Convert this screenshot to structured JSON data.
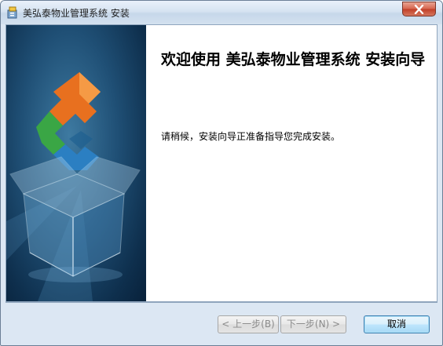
{
  "window": {
    "title": "美弘泰物业管理系统 安装",
    "icon": "installer-icon",
    "close_icon": "close-icon"
  },
  "content": {
    "heading": "欢迎使用 美弘泰物业管理系统 安装向导",
    "message": "请稍候，安装向导正准备指导您完成安装。"
  },
  "banner": {
    "image": "puzzle-box-illustration"
  },
  "buttons": {
    "back_label": "< 上一步(B)",
    "next_label": "下一步(N) >",
    "cancel_label": "取消"
  }
}
